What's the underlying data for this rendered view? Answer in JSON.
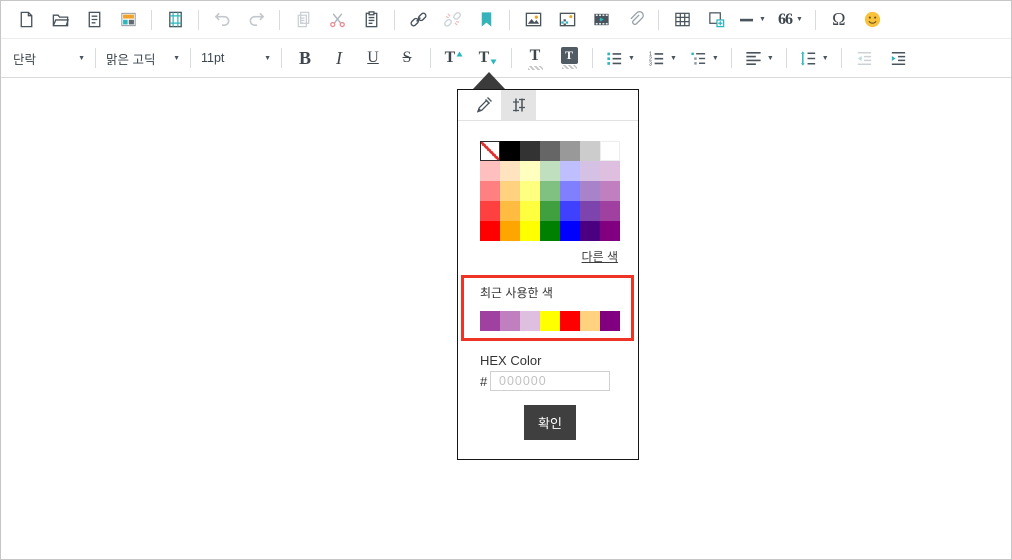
{
  "toolbar_insert": {
    "icons": [
      "new-document",
      "open-file",
      "document",
      "template",
      "print-frame",
      "undo",
      "redo",
      "copy",
      "cut",
      "paste",
      "link",
      "unlink",
      "bookmark",
      "image",
      "photo",
      "video",
      "attachment",
      "table",
      "insert-frame",
      "horizontal-line",
      "blockquote",
      "special-character",
      "emoticon"
    ],
    "blockquote_label": "66",
    "special_character_label": "Ω"
  },
  "toolbar_format": {
    "paragraph_select": "단락",
    "font_select": "맑은 고딕",
    "font_size_select": "11pt",
    "bold_label": "B",
    "italic_label": "I",
    "underline_label": "U",
    "strikethrough_label": "S",
    "superscript_label": "T",
    "subscript_label": "T",
    "text_color_label": "T",
    "background_color_label": "T"
  },
  "color_picker": {
    "tabs": [
      "eyedropper",
      "palette-settings"
    ],
    "active_tab": "palette-settings",
    "palette": [
      [
        "transparent",
        "#000000",
        "#333333",
        "#666666",
        "#999999",
        "#cccccc",
        "#ffffff"
      ],
      [
        "#ffbfbf",
        "#ffe4bf",
        "#ffffbf",
        "#bfdfbf",
        "#bfbfff",
        "#d5c1e4",
        "#dfbfdf"
      ],
      [
        "#ff8080",
        "#ffd280",
        "#ffff80",
        "#80c080",
        "#8080ff",
        "#a983c9",
        "#c080c0"
      ],
      [
        "#ff4040",
        "#ffbc40",
        "#ffff40",
        "#40a040",
        "#4040ff",
        "#7e44ae",
        "#a040a0"
      ],
      [
        "#ff0000",
        "#ffa500",
        "#ffff00",
        "#008000",
        "#0000ff",
        "#4b0082",
        "#800080"
      ]
    ],
    "other_colors_link": "다른 색",
    "recent_section": {
      "label": "최근 사용한 색",
      "colors": [
        "#a040a0",
        "#c080c0",
        "#dfbfdf",
        "#ffff00",
        "#ff0000",
        "#ffd280",
        "#800080"
      ],
      "highlight_border": "#ee3424"
    },
    "hex_section": {
      "label": "HEX Color",
      "prefix": "#",
      "placeholder": "000000"
    },
    "confirm_label": "확인"
  },
  "colors": {
    "accent_teal": "#2fb5bc",
    "icon": "#4a545c",
    "icon_disabled": "#c9ced4",
    "confirm_bg": "#3f3f3f",
    "annotation_red": "#ee3424"
  }
}
